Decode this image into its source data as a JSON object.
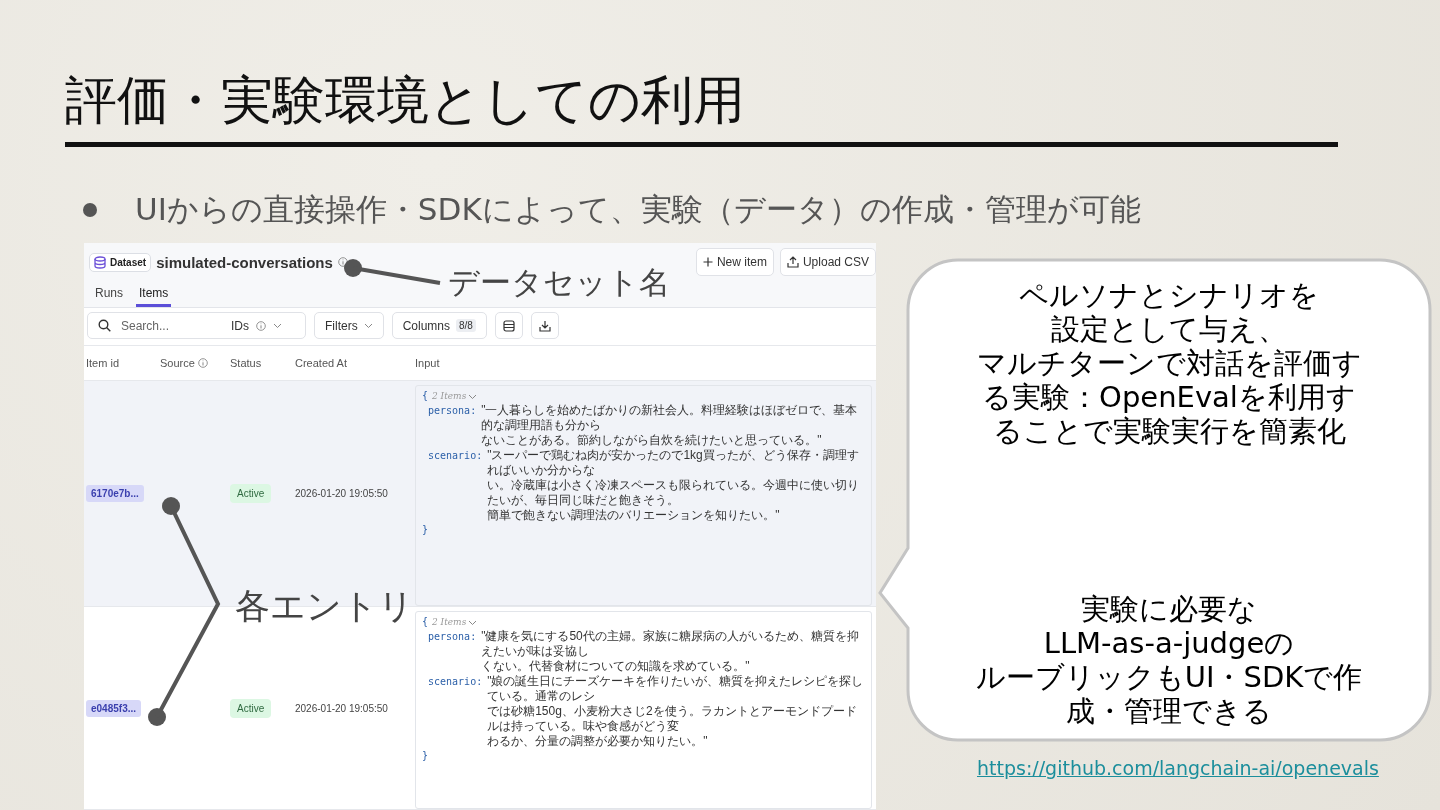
{
  "slide": {
    "title": "評価・実験環境としての利用",
    "bullet": "UIからの直接操作・SDKによって、実験（データ）の作成・管理が可能"
  },
  "dataset": {
    "badge": "Dataset",
    "name": "simulated-conversations",
    "buttons": [
      {
        "kind": "new",
        "label": "New item"
      },
      {
        "kind": "upload",
        "label": "Upload CSV"
      }
    ],
    "tabs": [
      {
        "label": "Runs",
        "selected": false
      },
      {
        "label": "Items",
        "selected": true
      }
    ],
    "toolbar": {
      "search_placeholder": "Search...",
      "ids": "IDs",
      "filters": "Filters",
      "columns": "Columns",
      "columns_count": "8/8"
    },
    "columns": [
      {
        "label": "Item id",
        "info": false
      },
      {
        "label": "Source",
        "info": true
      },
      {
        "label": "Status",
        "info": false
      },
      {
        "label": "Created At",
        "info": false
      },
      {
        "label": "Input",
        "info": false
      }
    ],
    "rows": [
      {
        "item_id": "6170e7b...",
        "status": "Active",
        "created_at": "2026-01-20 19:05:50",
        "selected": true,
        "open": "{",
        "summary": "2 Items",
        "close": "}",
        "fields": [
          {
            "key": "persona:",
            "lines": [
              "\"一人暮らしを始めたばかりの新社会人。料理経験はほぼゼロで、基本的な調理用語も分から",
              "ないことがある。節約しながら自炊を続けたいと思っている。\""
            ]
          },
          {
            "key": "scenario:",
            "lines": [
              "\"スーパーで鶏むね肉が安かったので1kg買ったが、どう保存・調理すればいいか分からな",
              "い。冷蔵庫は小さく冷凍スペースも限られている。今週中に使い切りたいが、毎日同じ味だと飽きそう。",
              "簡単で飽きない調理法のバリエーションを知りたい。\""
            ]
          }
        ]
      },
      {
        "item_id": "e0485f3...",
        "status": "Active",
        "created_at": "2026-01-20 19:05:50",
        "selected": false,
        "open": "{",
        "summary": "2 Items",
        "close": "}",
        "fields": [
          {
            "key": "persona:",
            "lines": [
              "\"健康を気にする50代の主婦。家族に糖尿病の人がいるため、糖質を抑えたいが味は妥協し",
              "くない。代替食材についての知識を求めている。\""
            ]
          },
          {
            "key": "scenario:",
            "lines": [
              "\"娘の誕生日にチーズケーキを作りたいが、糖質を抑えたレシピを探している。通常のレシ",
              "では砂糖150g、小麦粉大さじ2を使う。ラカントとアーモンドプードルは持っている。味や食感がどう変",
              "わるか、分量の調整が必要か知りたい。\""
            ]
          }
        ]
      }
    ]
  },
  "annotations": [
    {
      "kind": "name",
      "text": "データセット名"
    },
    {
      "kind": "entries",
      "text": "各エントリ"
    }
  ],
  "callout": {
    "paragraphs": [
      {
        "lines": [
          "ペルソナとシナリオを",
          "設定として与え、",
          "マルチターンで対話を評価す",
          "る実験：OpenEvalを利用す",
          "ることで実験実行を簡素化"
        ]
      },
      {
        "lines": [
          "実験に必要な",
          "LLM-as-a-judgeの",
          "ルーブリックもUI・SDKで作",
          "成・管理できる"
        ]
      }
    ]
  },
  "link": "https://github.com/langchain-ai/openevals"
}
